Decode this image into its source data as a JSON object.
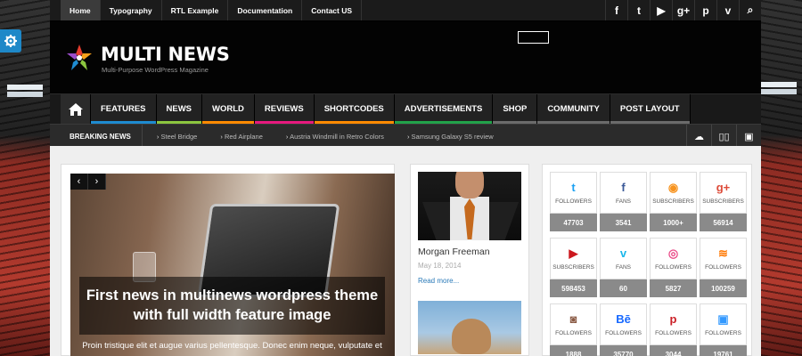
{
  "topnav": [
    "Home",
    "Typography",
    "RTL Example",
    "Documentation",
    "Contact US"
  ],
  "social_icons": [
    "facebook-icon",
    "twitter-icon",
    "youtube-icon",
    "google-plus-icon",
    "pinterest-icon",
    "vimeo-icon",
    "search-icon"
  ],
  "social_glyphs": [
    "f",
    "t",
    "▶",
    "g+",
    "p",
    "v",
    "⌕"
  ],
  "logo": {
    "title": "MULTI NEWS",
    "subtitle": "Multi-Purpose WordPress Magazine"
  },
  "mainnav": [
    {
      "label": "FEATURES",
      "color": "#1e8bd0"
    },
    {
      "label": "NEWS",
      "color": "#8cc63f"
    },
    {
      "label": "WORLD",
      "color": "#ff8a00"
    },
    {
      "label": "REVIEWS",
      "color": "#e6197e"
    },
    {
      "label": "SHORTCODES",
      "color": "#ff8a00"
    },
    {
      "label": "ADVERTISEMENTS",
      "color": "#22a24a"
    },
    {
      "label": "SHOP",
      "color": "#6b6b6b"
    },
    {
      "label": "COMMUNITY",
      "color": "#6b6b6b"
    },
    {
      "label": "POST LAYOUT",
      "color": "#6b6b6b"
    }
  ],
  "breaking": {
    "label": "BREAKING NEWS",
    "items": [
      "Steel Bridge",
      "Red Airplane",
      "Austria Windmill in Retro Colors",
      "Samsung Galaxy S5 review"
    ]
  },
  "slider": {
    "title": "First news in multinews wordpress theme with full width feature image",
    "excerpt": "Proin tristique elit et augue varius pellentesque. Donec enim neque, vulputate et"
  },
  "post": {
    "title": "Morgan Freeman",
    "date": "May 18, 2014",
    "more": "Read more..."
  },
  "counters": [
    {
      "icon": "t",
      "name": "twitter-icon",
      "color": "#1da1f2",
      "label": "FOLLOWERS",
      "value": "47703"
    },
    {
      "icon": "f",
      "name": "facebook-icon",
      "color": "#3b5998",
      "label": "FANS",
      "value": "3541"
    },
    {
      "icon": "◉",
      "name": "rss-icon",
      "color": "#f7931e",
      "label": "SUBSCRIBERS",
      "value": "1000+"
    },
    {
      "icon": "g+",
      "name": "google-plus-icon",
      "color": "#dd4b39",
      "label": "SUBSCRIBERS",
      "value": "56914"
    },
    {
      "icon": "▶",
      "name": "youtube-icon",
      "color": "#cc181e",
      "label": "SUBSCRIBERS",
      "value": "598453"
    },
    {
      "icon": "v",
      "name": "vimeo-icon",
      "color": "#1ab7ea",
      "label": "FANS",
      "value": "60"
    },
    {
      "icon": "◎",
      "name": "dribbble-icon",
      "color": "#ea4c89",
      "label": "FOLLOWERS",
      "value": "5827"
    },
    {
      "icon": "≋",
      "name": "soundcloud-icon",
      "color": "#ff7700",
      "label": "FOLLOWERS",
      "value": "100259"
    },
    {
      "icon": "◙",
      "name": "instagram-icon",
      "color": "#8a5a44",
      "label": "FOLLOWERS",
      "value": "1888"
    },
    {
      "icon": "Bē",
      "name": "behance-icon",
      "color": "#1769ff",
      "label": "FOLLOWERS",
      "value": "35770"
    },
    {
      "icon": "p",
      "name": "pinterest-icon",
      "color": "#cb2027",
      "label": "FOLLOWERS",
      "value": "3044"
    },
    {
      "icon": "▣",
      "name": "delicious-icon",
      "color": "#3399ff",
      "label": "FOLLOWERS",
      "value": "19761"
    }
  ]
}
